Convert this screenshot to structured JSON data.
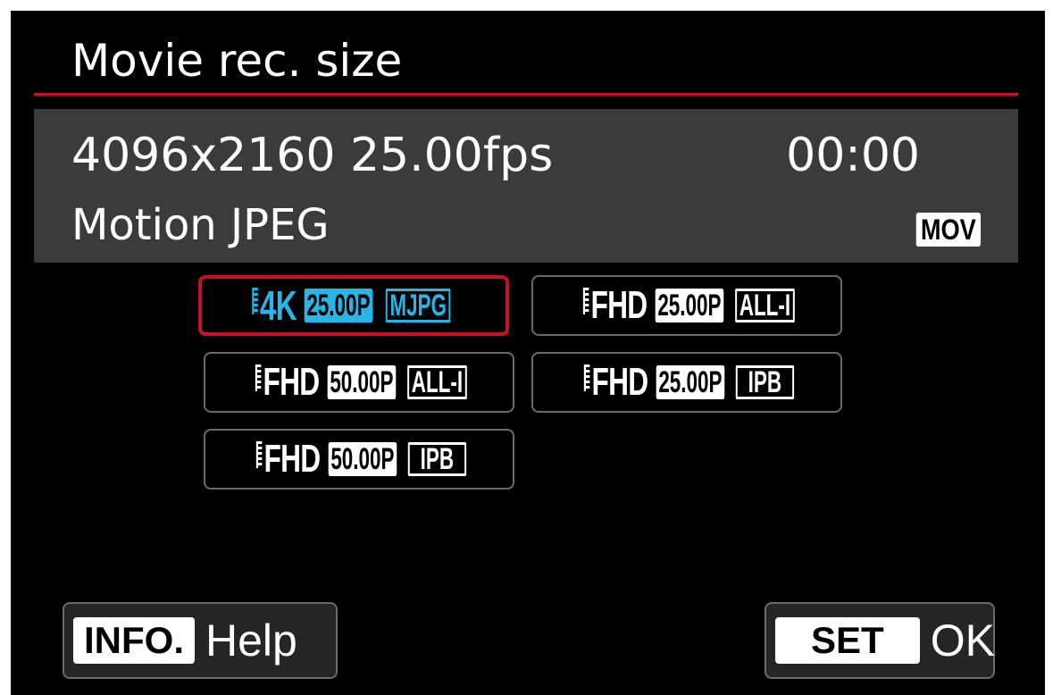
{
  "screen": {
    "title": "Movie rec. size"
  },
  "info_panel": {
    "resolution_fps": "4096x2160 25.00fps",
    "time_remaining": "00:00",
    "codec": "Motion JPEG",
    "container_badge": "MOV"
  },
  "options": [
    {
      "resolution": "4K",
      "fps": "25.00P",
      "compression": "MJPG",
      "selected": true
    },
    {
      "resolution": "FHD",
      "fps": "25.00P",
      "compression": "ALL-I",
      "selected": false
    },
    {
      "resolution": "FHD",
      "fps": "50.00P",
      "compression": "ALL-I",
      "selected": false
    },
    {
      "resolution": "FHD",
      "fps": "25.00P",
      "compression": "IPB",
      "selected": false
    },
    {
      "resolution": "FHD",
      "fps": "50.00P",
      "compression": "IPB",
      "selected": false
    }
  ],
  "footer": {
    "info_key": "INFO.",
    "info_label": "Help",
    "set_key": "SET",
    "set_label": "OK"
  },
  "colors": {
    "accent_red": "#c8102e",
    "highlight_cyan": "#27b5e8",
    "panel_gray": "#3b3b3b",
    "background": "#000000"
  }
}
